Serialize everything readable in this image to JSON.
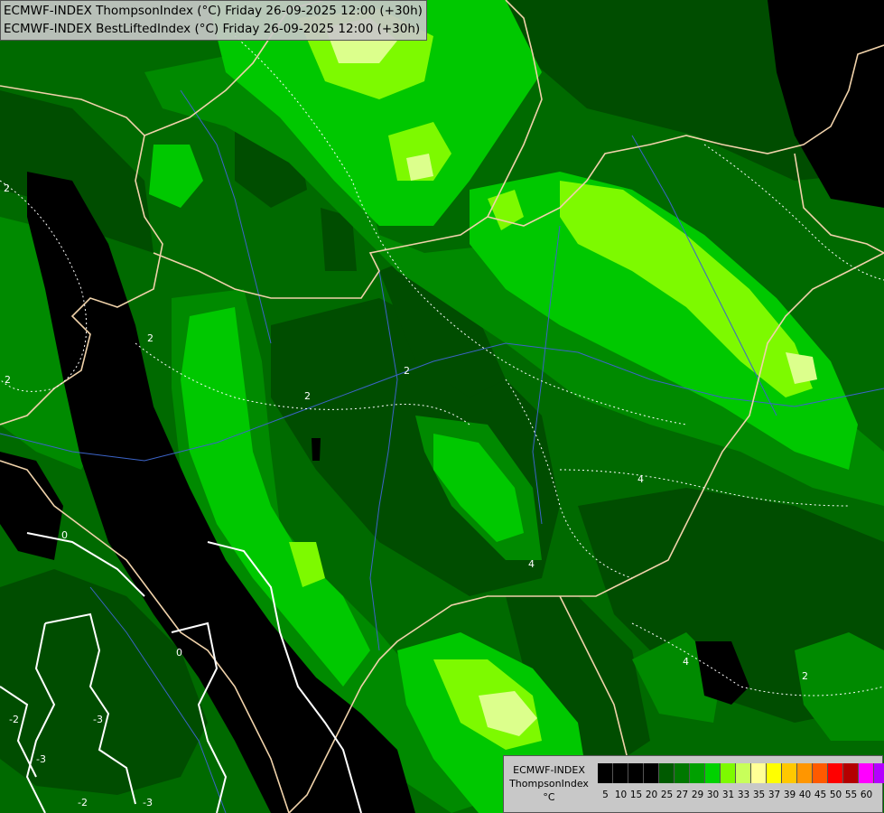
{
  "titles": {
    "line1": "ECMWF-INDEX ThompsonIndex (°C) Friday 26-09-2025 12:00 (+30h)",
    "line2": "ECMWF-INDEX BestLiftedIndex (°C) Friday 26-09-2025 12:00 (+30h)"
  },
  "legend": {
    "model": "ECMWF-INDEX",
    "parameter": "ThompsonIndex",
    "unit": "°C",
    "scale": [
      {
        "label": "5",
        "color": "#000000"
      },
      {
        "label": "10",
        "color": "#000000"
      },
      {
        "label": "15",
        "color": "#000000"
      },
      {
        "label": "20",
        "color": "#000000"
      },
      {
        "label": "25",
        "color": "#005a00"
      },
      {
        "label": "27",
        "color": "#007800"
      },
      {
        "label": "29",
        "color": "#00a000"
      },
      {
        "label": "30",
        "color": "#00d200"
      },
      {
        "label": "31",
        "color": "#7dfa00"
      },
      {
        "label": "33",
        "color": "#c8ff5a"
      },
      {
        "label": "35",
        "color": "#ffff96"
      },
      {
        "label": "37",
        "color": "#ffff00"
      },
      {
        "label": "39",
        "color": "#ffc800"
      },
      {
        "label": "40",
        "color": "#ff9600"
      },
      {
        "label": "45",
        "color": "#ff5a00"
      },
      {
        "label": "50",
        "color": "#ff0000"
      },
      {
        "label": "55",
        "color": "#b40000"
      },
      {
        "label": "60",
        "color": "#ff00ff"
      },
      {
        "label": "",
        "color": "#b400ff"
      },
      {
        "label": "",
        "color": "#6400ff"
      },
      {
        "label": "",
        "color": "#0000ff"
      }
    ]
  },
  "contour_labels": [
    "2",
    "2",
    "2",
    "2",
    "2",
    "4",
    "4",
    "4",
    "2",
    "0",
    "0",
    "-3",
    "-2",
    "-3",
    "-2",
    "-3"
  ]
}
